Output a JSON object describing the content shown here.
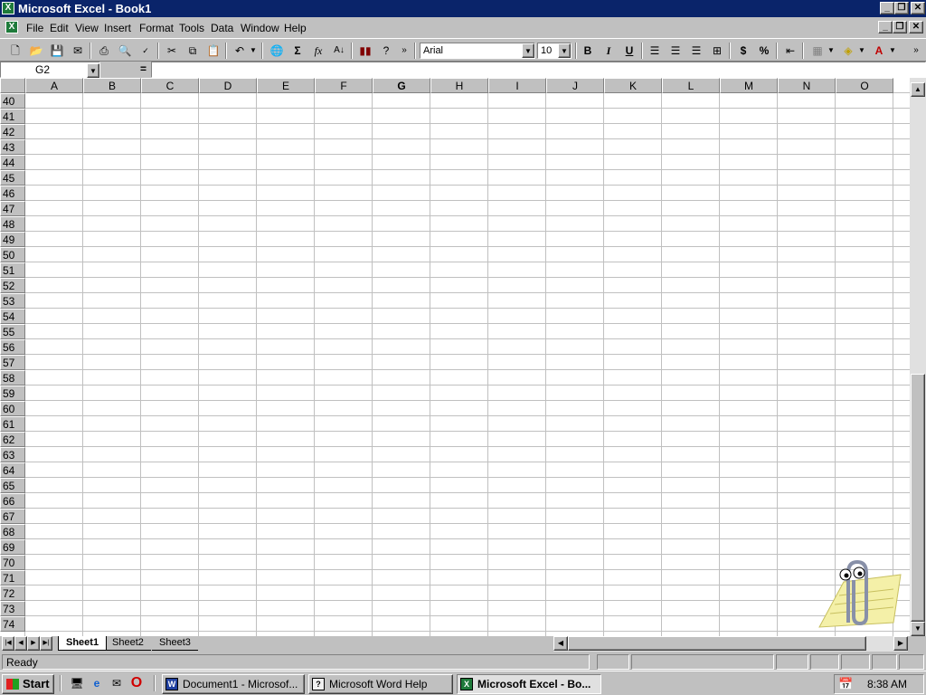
{
  "window": {
    "title": "Microsoft Excel - Book1"
  },
  "menu": {
    "items": [
      "File",
      "Edit",
      "View",
      "Insert",
      "Format",
      "Tools",
      "Data",
      "Window",
      "Help"
    ]
  },
  "toolbar": {
    "icons": [
      "new-icon",
      "open-icon",
      "save-icon",
      "email-icon",
      "print-icon",
      "print-preview-icon",
      "spelling-icon",
      "cut-icon",
      "copy-icon",
      "paste-icon",
      "undo-icon",
      "hyperlink-icon",
      "autosum-icon",
      "paste-function-icon",
      "sort-ascending-icon",
      "chart-wizard-icon",
      "help-icon",
      "more-buttons-icon"
    ],
    "font": "Arial",
    "size": "10",
    "bold": "B",
    "italic": "I",
    "underline": "U",
    "currency": "$",
    "percent": "%"
  },
  "formula": {
    "name_box": "G2",
    "equals": "=",
    "value": ""
  },
  "grid": {
    "columns": [
      "A",
      "B",
      "C",
      "D",
      "E",
      "F",
      "G",
      "H",
      "I",
      "J",
      "K",
      "L",
      "M",
      "N",
      "O"
    ],
    "rows": [
      "40",
      "41",
      "42",
      "43",
      "44",
      "45",
      "46",
      "47",
      "48",
      "49",
      "50",
      "51",
      "52",
      "53",
      "54",
      "55",
      "56",
      "57",
      "58",
      "59",
      "60",
      "61",
      "62",
      "63",
      "64",
      "65",
      "66",
      "67",
      "68",
      "69",
      "70",
      "71",
      "72",
      "73",
      "74"
    ]
  },
  "sheets": {
    "tabs": [
      "Sheet1",
      "Sheet2",
      "Sheet3"
    ],
    "active": "Sheet1"
  },
  "status": {
    "text": "Ready"
  },
  "taskbar": {
    "start": "Start",
    "tasks": [
      "Document1 - Microsof...",
      "Microsoft Word Help",
      "Microsoft Excel - Bo..."
    ],
    "clock": "8:38 AM"
  },
  "colors": {
    "titlebar": "#0a246a",
    "excel_green": "#1e7a3a"
  }
}
